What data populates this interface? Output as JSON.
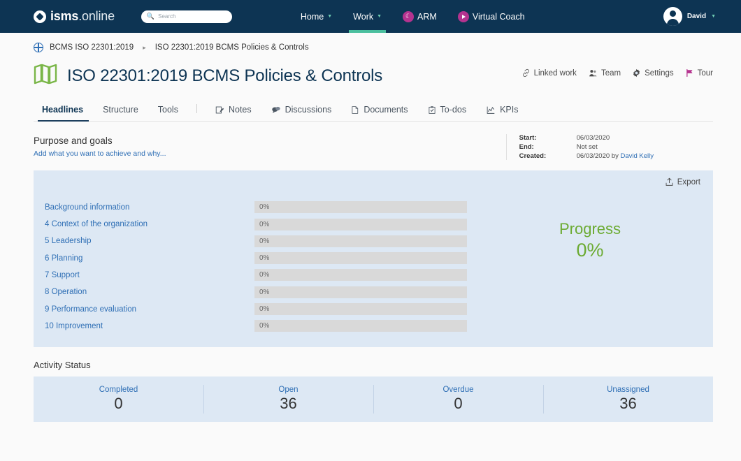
{
  "topnav": {
    "logo_bold": "isms",
    "logo_light": ".online",
    "search_placeholder": "Search",
    "links": [
      {
        "label": "Home",
        "icon": "chevron-down-icon",
        "active": false
      },
      {
        "label": "Work",
        "icon": "chevron-down-icon",
        "active": true
      }
    ],
    "arm_label": "ARM",
    "virtual_coach_label": "Virtual Coach",
    "user_name": "David",
    "accent_active": "#4bbf9e",
    "brand_bg": "#0d3453",
    "pill_color": "#b5338f"
  },
  "breadcrumb": {
    "root": "BCMS ISO 22301:2019",
    "separator": "▸",
    "current": "ISO 22301:2019 BCMS Policies & Controls"
  },
  "header": {
    "title": "ISO 22301:2019 BCMS Policies & Controls",
    "actions": [
      {
        "label": "Linked work",
        "icon": "link-icon"
      },
      {
        "label": "Team",
        "icon": "people-icon"
      },
      {
        "label": "Settings",
        "icon": "gear-icon"
      },
      {
        "label": "Tour",
        "icon": "flag-icon"
      }
    ]
  },
  "tabs": [
    {
      "label": "Headlines",
      "icon": null,
      "active": true
    },
    {
      "label": "Structure",
      "icon": null,
      "active": false
    },
    {
      "label": "Tools",
      "icon": null,
      "active": false
    },
    {
      "label": "Notes",
      "icon": "pencil-note-icon",
      "active": false
    },
    {
      "label": "Discussions",
      "icon": "speech-bubble-icon",
      "active": false
    },
    {
      "label": "Documents",
      "icon": "document-icon",
      "active": false
    },
    {
      "label": "To-dos",
      "icon": "clipboard-check-icon",
      "active": false
    },
    {
      "label": "KPIs",
      "icon": "line-chart-icon",
      "active": false
    }
  ],
  "purpose": {
    "heading": "Purpose and goals",
    "link": "Add what you want to achieve and why..."
  },
  "meta": {
    "start_label": "Start:",
    "start_value": "06/03/2020",
    "end_label": "End:",
    "end_value": "Not set",
    "created_label": "Created:",
    "created_value": "06/03/2020 by ",
    "created_by": "David Kelly"
  },
  "progress_panel": {
    "export_label": "Export",
    "summary_label": "Progress",
    "summary_value": "0%",
    "summary_color": "#6cab33"
  },
  "chart_data": {
    "type": "bar",
    "title": "Progress",
    "xlabel": "",
    "ylabel": "",
    "xlim": [
      0,
      100
    ],
    "unit": "%",
    "categories": [
      "Background information",
      "4 Context of the organization",
      "5 Leadership",
      "6 Planning",
      "7 Support",
      "8 Operation",
      "9 Performance evaluation",
      "10 Improvement"
    ],
    "values": [
      0,
      0,
      0,
      0,
      0,
      0,
      0,
      0
    ],
    "value_labels": [
      "0%",
      "0%",
      "0%",
      "0%",
      "0%",
      "0%",
      "0%",
      "0%"
    ],
    "overall": 0,
    "overall_label": "0%",
    "track_color": "#d9d9d9",
    "fill_color": "#6cab33",
    "grid": false,
    "legend": false
  },
  "activity": {
    "heading": "Activity Status",
    "stats": [
      {
        "label": "Completed",
        "value": "0"
      },
      {
        "label": "Open",
        "value": "36"
      },
      {
        "label": "Overdue",
        "value": "0"
      },
      {
        "label": "Unassigned",
        "value": "36"
      }
    ]
  }
}
